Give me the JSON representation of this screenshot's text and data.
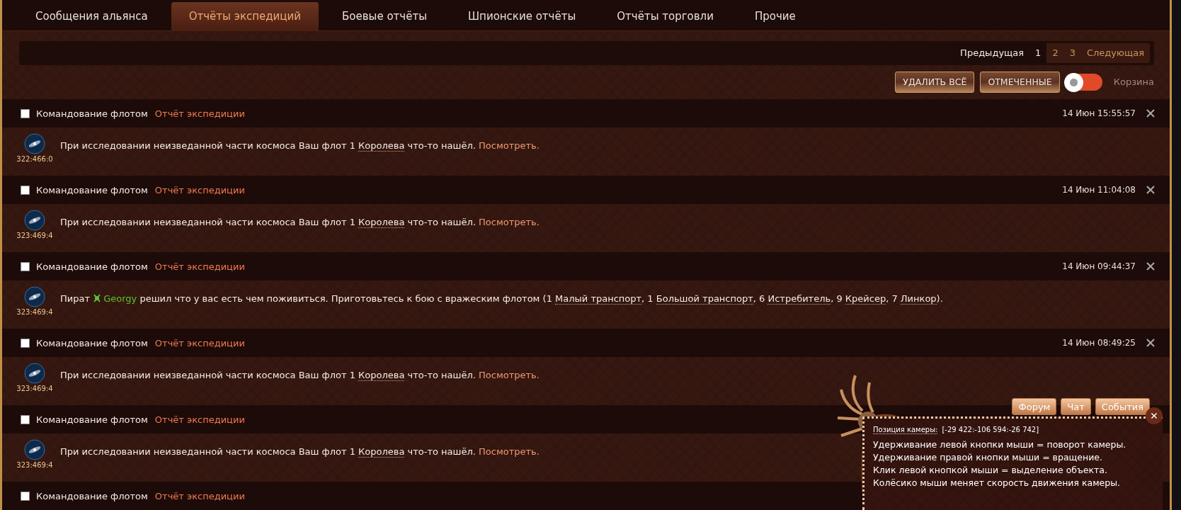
{
  "tabs": [
    {
      "label": "Сообщения альянса",
      "selected": false
    },
    {
      "label": "Отчёты экспедиций",
      "selected": true
    },
    {
      "label": "Боевые отчёты",
      "selected": false
    },
    {
      "label": "Шпионские отчёты",
      "selected": false
    },
    {
      "label": "Отчёты торговли",
      "selected": false
    },
    {
      "label": "Прочие",
      "selected": false
    }
  ],
  "pagination": {
    "previous": "Предыдущая",
    "next": "Следующая",
    "pages": [
      {
        "label": "1",
        "selected": true
      },
      {
        "label": "2",
        "selected": false
      },
      {
        "label": "3",
        "selected": false
      }
    ]
  },
  "actions": {
    "buttons": [
      "УДАЛИТЬ ВСЁ",
      "ОТМЕЧЕННЫЕ"
    ],
    "trash_toggle": {
      "label": "Корзина",
      "on": false
    }
  },
  "messages": [
    {
      "checked": false,
      "sender": "Командование флотом",
      "subject": "Отчёт экспедиции",
      "time": "14 Июн 15:55:57",
      "coords": "322:466:0",
      "body": [
        {
          "kind": "plain",
          "text": "При исследовании неизведанной части космоса Ваш флот 1 "
        },
        {
          "kind": "ship",
          "text": "Королева"
        },
        {
          "kind": "plain",
          "text": " что-то нашёл. "
        },
        {
          "kind": "link",
          "text": "Посмотреть."
        }
      ]
    },
    {
      "checked": false,
      "sender": "Командование флотом",
      "subject": "Отчёт экспедиции",
      "time": "14 Июн 11:04:08",
      "coords": "323:469:4",
      "body": [
        {
          "kind": "plain",
          "text": "При исследовании неизведанной части космоса Ваш флот 1 "
        },
        {
          "kind": "ship",
          "text": "Королева"
        },
        {
          "kind": "plain",
          "text": " что-то нашёл. "
        },
        {
          "kind": "link",
          "text": "Посмотреть."
        }
      ]
    },
    {
      "checked": false,
      "sender": "Командование флотом",
      "subject": "Отчёт экспедиции",
      "time": "14 Июн 09:44:37",
      "coords": "323:469:4",
      "body": [
        {
          "kind": "plain",
          "text": "Пират "
        },
        {
          "kind": "player",
          "text": "Georgy"
        },
        {
          "kind": "plain",
          "text": " решил что у вас есть чем поживиться. Приготовьтесь к бою с вражеским флотом (1 "
        },
        {
          "kind": "ship",
          "text": "Малый транспорт"
        },
        {
          "kind": "plain",
          "text": ", 1 "
        },
        {
          "kind": "ship",
          "text": "Большой транспорт"
        },
        {
          "kind": "plain",
          "text": ", 6 "
        },
        {
          "kind": "ship",
          "text": "Истребитель"
        },
        {
          "kind": "plain",
          "text": ", 9 "
        },
        {
          "kind": "ship",
          "text": "Крейсер"
        },
        {
          "kind": "plain",
          "text": ", 7 "
        },
        {
          "kind": "ship",
          "text": "Линкор"
        },
        {
          "kind": "plain",
          "text": ")."
        }
      ]
    },
    {
      "checked": false,
      "sender": "Командование флотом",
      "subject": "Отчёт экспедиции",
      "time": "14 Июн 08:49:25",
      "coords": "323:469:4",
      "body": [
        {
          "kind": "plain",
          "text": "При исследовании неизведанной части космоса Ваш флот 1 "
        },
        {
          "kind": "ship",
          "text": "Королева"
        },
        {
          "kind": "plain",
          "text": " что-то нашёл. "
        },
        {
          "kind": "link",
          "text": "Посмотреть."
        }
      ]
    },
    {
      "checked": false,
      "sender": "Командование флотом",
      "subject": "Отчёт экспедиции",
      "coords": "323:469:4",
      "body": [
        {
          "kind": "plain",
          "text": "При исследовании неизведанной части космоса Ваш флот 1 "
        },
        {
          "kind": "ship",
          "text": "Королева"
        },
        {
          "kind": "plain",
          "text": " что-то нашёл. "
        },
        {
          "kind": "link",
          "text": "Посмотреть."
        }
      ]
    },
    {
      "checked": false,
      "sender": "Командование флотом",
      "subject": "Отчёт экспедиции"
    }
  ],
  "overlay": {
    "buttons": [
      "Форум",
      "Чат",
      "События"
    ],
    "camera_label": "Позиция камеры:",
    "camera_value": "[-29 422:-106 594:-26 742]",
    "help_lines": [
      "Удерживание левой кнопки мыши = поворот камеры.",
      "Удерживание правой кнопки мыши = вращение.",
      "Клик левой кнопкой мыши = выделение объекта.",
      "Колёсико мыши меняет скорость движения камеры."
    ]
  }
}
